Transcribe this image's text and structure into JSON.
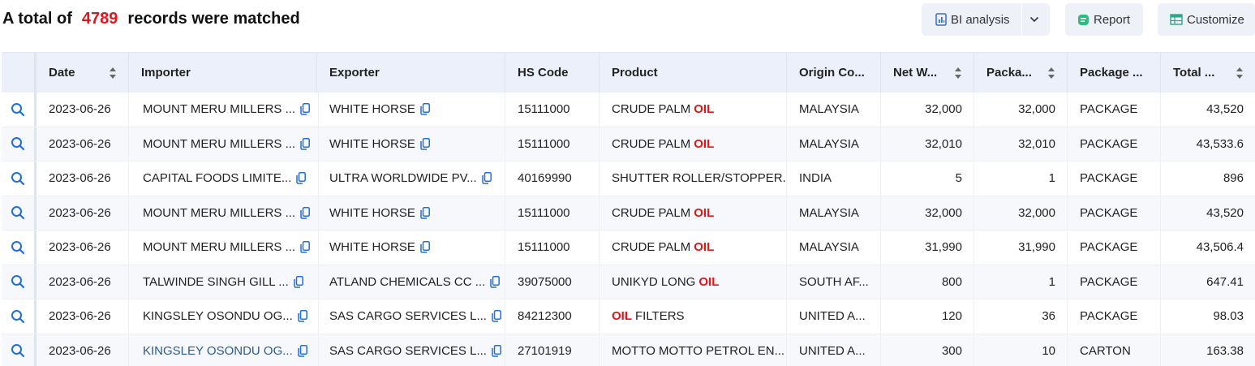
{
  "summary": {
    "prefix": "A total of",
    "count": "4789",
    "suffix": "records were matched"
  },
  "toolbar": {
    "bi_label": "BI analysis",
    "report_label": "Report",
    "customize_label": "Customize"
  },
  "colors": {
    "accent": "#e8141b",
    "header_bg": "#ecf0fb",
    "icon_blue": "#1e6fd9",
    "button_bg": "#eef1f7"
  },
  "table": {
    "headers": [
      "Date",
      "Importer",
      "Exporter",
      "HS Code",
      "Product",
      "Origin Co...",
      "Net W...",
      "Packa...",
      "Package ...",
      "Total ..."
    ],
    "rows": [
      {
        "date": "2023-06-26",
        "importer": "MOUNT MERU MILLERS ...",
        "exporter": "WHITE HORSE",
        "hs": "15111000",
        "product": "CRUDE PALM",
        "highlight": "OIL",
        "origin": "MALAYSIA",
        "net": "32,000",
        "packages": "32,000",
        "unit": "PACKAGE",
        "total": "43,520"
      },
      {
        "date": "2023-06-26",
        "importer": "MOUNT MERU MILLERS ...",
        "exporter": "WHITE HORSE",
        "hs": "15111000",
        "product": "CRUDE PALM",
        "highlight": "OIL",
        "origin": "MALAYSIA",
        "net": "32,010",
        "packages": "32,010",
        "unit": "PACKAGE",
        "total": "43,533.6"
      },
      {
        "date": "2023-06-26",
        "importer": "CAPITAL FOODS LIMITE...",
        "exporter": "ULTRA WORLDWIDE PV...",
        "hs": "40169990",
        "product": "SHUTTER ROLLER/STOPPER...",
        "highlight": "",
        "origin": "INDIA",
        "net": "5",
        "packages": "1",
        "unit": "PACKAGE",
        "total": "896"
      },
      {
        "date": "2023-06-26",
        "importer": "MOUNT MERU MILLERS ...",
        "exporter": "WHITE HORSE",
        "hs": "15111000",
        "product": "CRUDE PALM",
        "highlight": "OIL",
        "origin": "MALAYSIA",
        "net": "32,000",
        "packages": "32,000",
        "unit": "PACKAGE",
        "total": "43,520"
      },
      {
        "date": "2023-06-26",
        "importer": "MOUNT MERU MILLERS ...",
        "exporter": "WHITE HORSE",
        "hs": "15111000",
        "product": "CRUDE PALM",
        "highlight": "OIL",
        "origin": "MALAYSIA",
        "net": "31,990",
        "packages": "31,990",
        "unit": "PACKAGE",
        "total": "43,506.4"
      },
      {
        "date": "2023-06-26",
        "importer": "TALWINDE SINGH GILL ...",
        "exporter": "ATLAND CHEMICALS CC ...",
        "hs": "39075000",
        "product": "UNIKYD LONG",
        "highlight": "OIL",
        "origin": "SOUTH AF...",
        "net": "800",
        "packages": "1",
        "unit": "PACKAGE",
        "total": "647.41"
      },
      {
        "date": "2023-06-26",
        "importer": "KINGSLEY OSONDU OG...",
        "exporter": "SAS CARGO SERVICES L...",
        "hs": "84212300",
        "product": "FILTERS",
        "highlight_first": "OIL",
        "origin": "UNITED A...",
        "net": "120",
        "packages": "36",
        "unit": "PACKAGE",
        "total": "98.03"
      },
      {
        "date": "2023-06-26",
        "importer": "KINGSLEY OSONDU OG...",
        "exporter": "SAS CARGO SERVICES L...",
        "hs": "27101919",
        "product": "MOTTO MOTTO PETROL EN...",
        "highlight": "",
        "origin": "UNITED A...",
        "net": "300",
        "packages": "10",
        "unit": "CARTON",
        "total": "163.38"
      }
    ]
  }
}
